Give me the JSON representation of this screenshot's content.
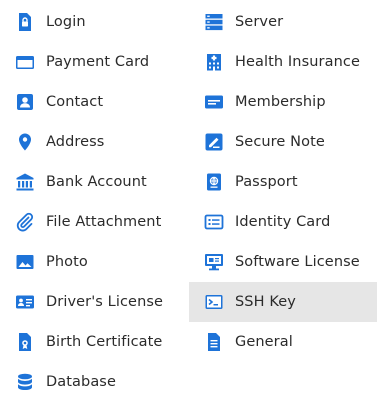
{
  "accent_color": "#1e73d8",
  "selected_item": "SSH Key",
  "left_column": [
    {
      "label": "Login",
      "icon": "lock-icon"
    },
    {
      "label": "Payment Card",
      "icon": "credit-card-icon"
    },
    {
      "label": "Contact",
      "icon": "contact-icon"
    },
    {
      "label": "Address",
      "icon": "map-pin-icon"
    },
    {
      "label": "Bank Account",
      "icon": "bank-icon"
    },
    {
      "label": "File Attachment",
      "icon": "paperclip-icon"
    },
    {
      "label": "Photo",
      "icon": "photo-icon"
    },
    {
      "label": "Driver's License",
      "icon": "id-card-icon"
    },
    {
      "label": "Birth Certificate",
      "icon": "certificate-icon"
    },
    {
      "label": "Database",
      "icon": "database-icon"
    }
  ],
  "right_column": [
    {
      "label": "Server",
      "icon": "server-icon"
    },
    {
      "label": "Health Insurance",
      "icon": "health-building-icon"
    },
    {
      "label": "Membership",
      "icon": "membership-card-icon"
    },
    {
      "label": "Secure Note",
      "icon": "note-pen-icon"
    },
    {
      "label": "Passport",
      "icon": "passport-icon"
    },
    {
      "label": "Identity Card",
      "icon": "identity-card-icon"
    },
    {
      "label": "Software License",
      "icon": "monitor-icon"
    },
    {
      "label": "SSH Key",
      "icon": "terminal-icon"
    },
    {
      "label": "General",
      "icon": "document-icon"
    }
  ]
}
